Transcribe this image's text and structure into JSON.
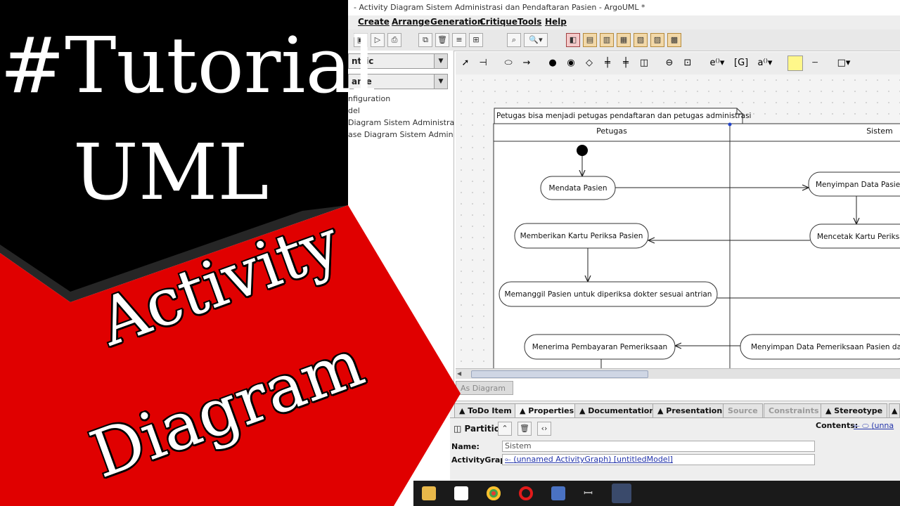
{
  "window": {
    "title": "- Activity Diagram Sistem Administrasi dan Pendaftaran Pasien - ArgoUML *"
  },
  "menu": [
    "Create",
    "Arrange",
    "Generation",
    "Critique",
    "Tools",
    "Help"
  ],
  "explorer": {
    "perspective_combo": "ntric",
    "order_combo": "ame",
    "tree": [
      "nfiguration",
      "del",
      "Diagram Sistem Administra",
      "ase Diagram Sistem Admin"
    ]
  },
  "diagram": {
    "note": "Petugas bisa menjadi petugas pendaftaran dan petugas administrasi",
    "partitions": [
      "Petugas",
      "Sistem"
    ],
    "activities": {
      "a1": "Mendata Pasien",
      "a2": "Menyimpan Data Pasien",
      "a3": "Mencetak Kartu Periksa",
      "a4": "Memberikan Kartu Periksa Pasien",
      "a5": "Memanggil Pasien untuk diperiksa dokter sesuai antrian",
      "a6": "Menyimpan Data Pemeriksaan Pasien dan",
      "a7": "Menerima Pembayaran Pemeriksaan"
    },
    "tab": "As Diagram"
  },
  "properties": {
    "tabs": [
      "ToDo Item",
      "Properties",
      "Documentation",
      "Presentation",
      "Source",
      "Constraints",
      "Stereotype"
    ],
    "element_type": "Partition",
    "contents_label": "Contents:",
    "contents_value": "(unna",
    "name_label": "Name:",
    "name_value": "Sistem",
    "activitygraph_label": "ActivityGraph:",
    "activitygraph_value": "(unnamed ActivityGraph) [untitledModel]"
  },
  "overlay": {
    "line1": "#Tutorial",
    "line2": "UML",
    "line3": "Activity",
    "line4": "Diagram",
    "colors": {
      "black_panel": "#000000",
      "red_panel": "#e00000",
      "text": "#ffffff"
    }
  }
}
